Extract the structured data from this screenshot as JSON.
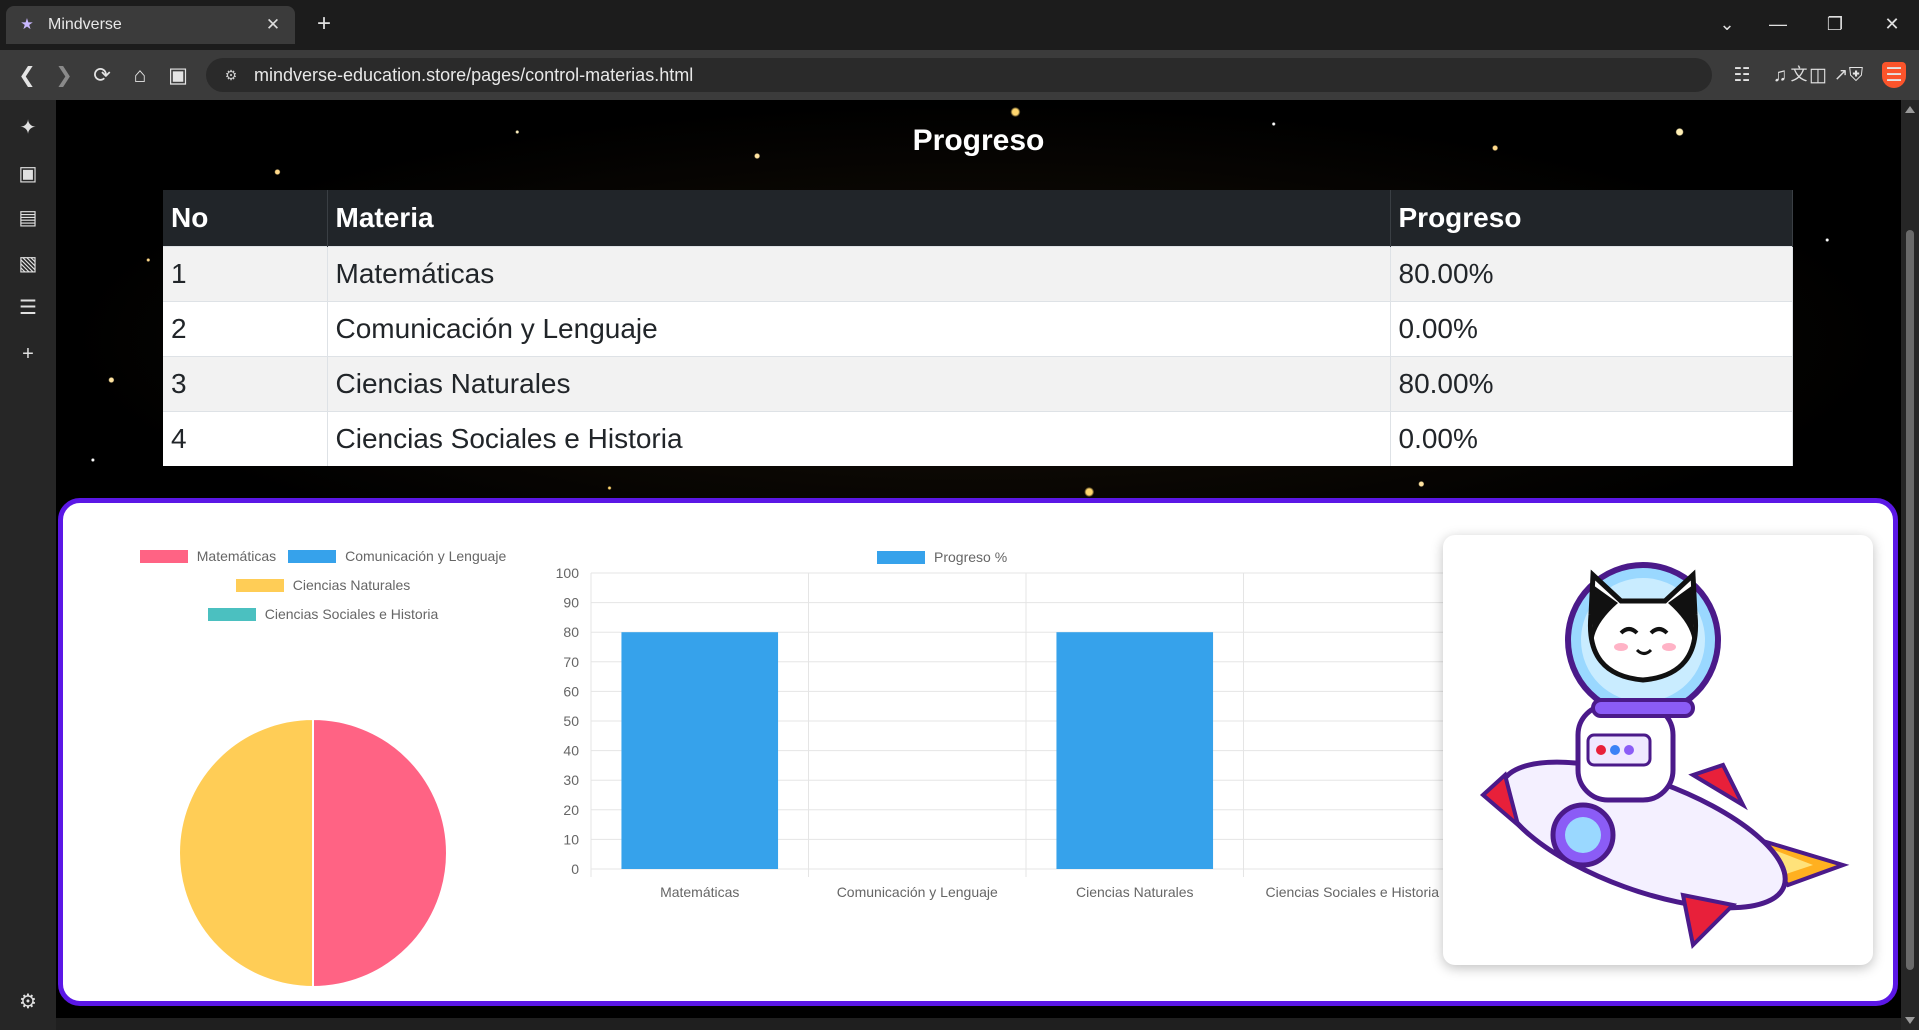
{
  "browser": {
    "tab_title": "Mindverse",
    "tab_favicon": "wizard-icon",
    "url": "mindverse-education.store/pages/control-materias.html"
  },
  "page": {
    "title": "Progreso"
  },
  "table": {
    "headers": [
      "No",
      "Materia",
      "Progreso"
    ],
    "rows": [
      {
        "no": "1",
        "materia": "Matemáticas",
        "progreso": "80.00%"
      },
      {
        "no": "2",
        "materia": "Comunicación y Lenguaje",
        "progreso": "0.00%"
      },
      {
        "no": "3",
        "materia": "Ciencias Naturales",
        "progreso": "80.00%"
      },
      {
        "no": "4",
        "materia": "Ciencias Sociales e Historia",
        "progreso": "0.00%"
      }
    ]
  },
  "colors": {
    "accent_border": "#5b17e6",
    "pie": [
      "#ff6384",
      "#36a2eb",
      "#ffcd56",
      "#4bc0c0"
    ],
    "bar": "#36a2eb"
  },
  "chart_data": [
    {
      "type": "pie",
      "categories": [
        "Matemáticas",
        "Comunicación y Lenguaje",
        "Ciencias Naturales",
        "Ciencias Sociales e Historia"
      ],
      "values": [
        80,
        0,
        80,
        0
      ],
      "legend": "top"
    },
    {
      "type": "bar",
      "categories": [
        "Matemáticas",
        "Comunicación y Lenguaje",
        "Ciencias Naturales",
        "Ciencias Sociales e Historia"
      ],
      "series": [
        {
          "name": "Progreso %",
          "values": [
            80,
            0,
            80,
            0
          ]
        }
      ],
      "ylim": [
        0,
        100
      ],
      "yticks": [
        "0",
        "10",
        "20",
        "30",
        "40",
        "50",
        "60",
        "70",
        "80",
        "90",
        "100"
      ],
      "grid": true,
      "legend": "top"
    }
  ],
  "image": {
    "subject": "astronaut-cat-on-rocket"
  }
}
